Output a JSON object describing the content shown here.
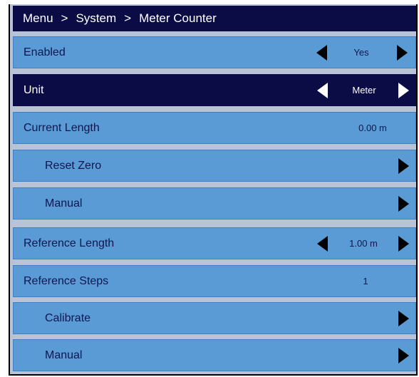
{
  "breadcrumb": {
    "item1": "Menu",
    "sep1": ">",
    "item2": "System",
    "sep2": ">",
    "item3": "Meter Counter"
  },
  "rows": [
    {
      "label": "Enabled",
      "value": "Yes"
    },
    {
      "label": "Unit",
      "value": "Meter"
    },
    {
      "label": "Current Length",
      "value": "0.00 m"
    },
    {
      "label": "Reset Zero"
    },
    {
      "label": "Manual"
    },
    {
      "label": "Reference Length",
      "value": "1.00 m"
    },
    {
      "label": "Reference Steps",
      "value": "1"
    },
    {
      "label": "Calibrate"
    },
    {
      "label": "Manual"
    }
  ],
  "colors": {
    "header": "#0b0c46",
    "row": "#5b9bd5",
    "selected_row": "#0b0c46",
    "text": "#0b1650"
  },
  "icons": [
    "left-arrow-icon",
    "right-arrow-icon"
  ]
}
